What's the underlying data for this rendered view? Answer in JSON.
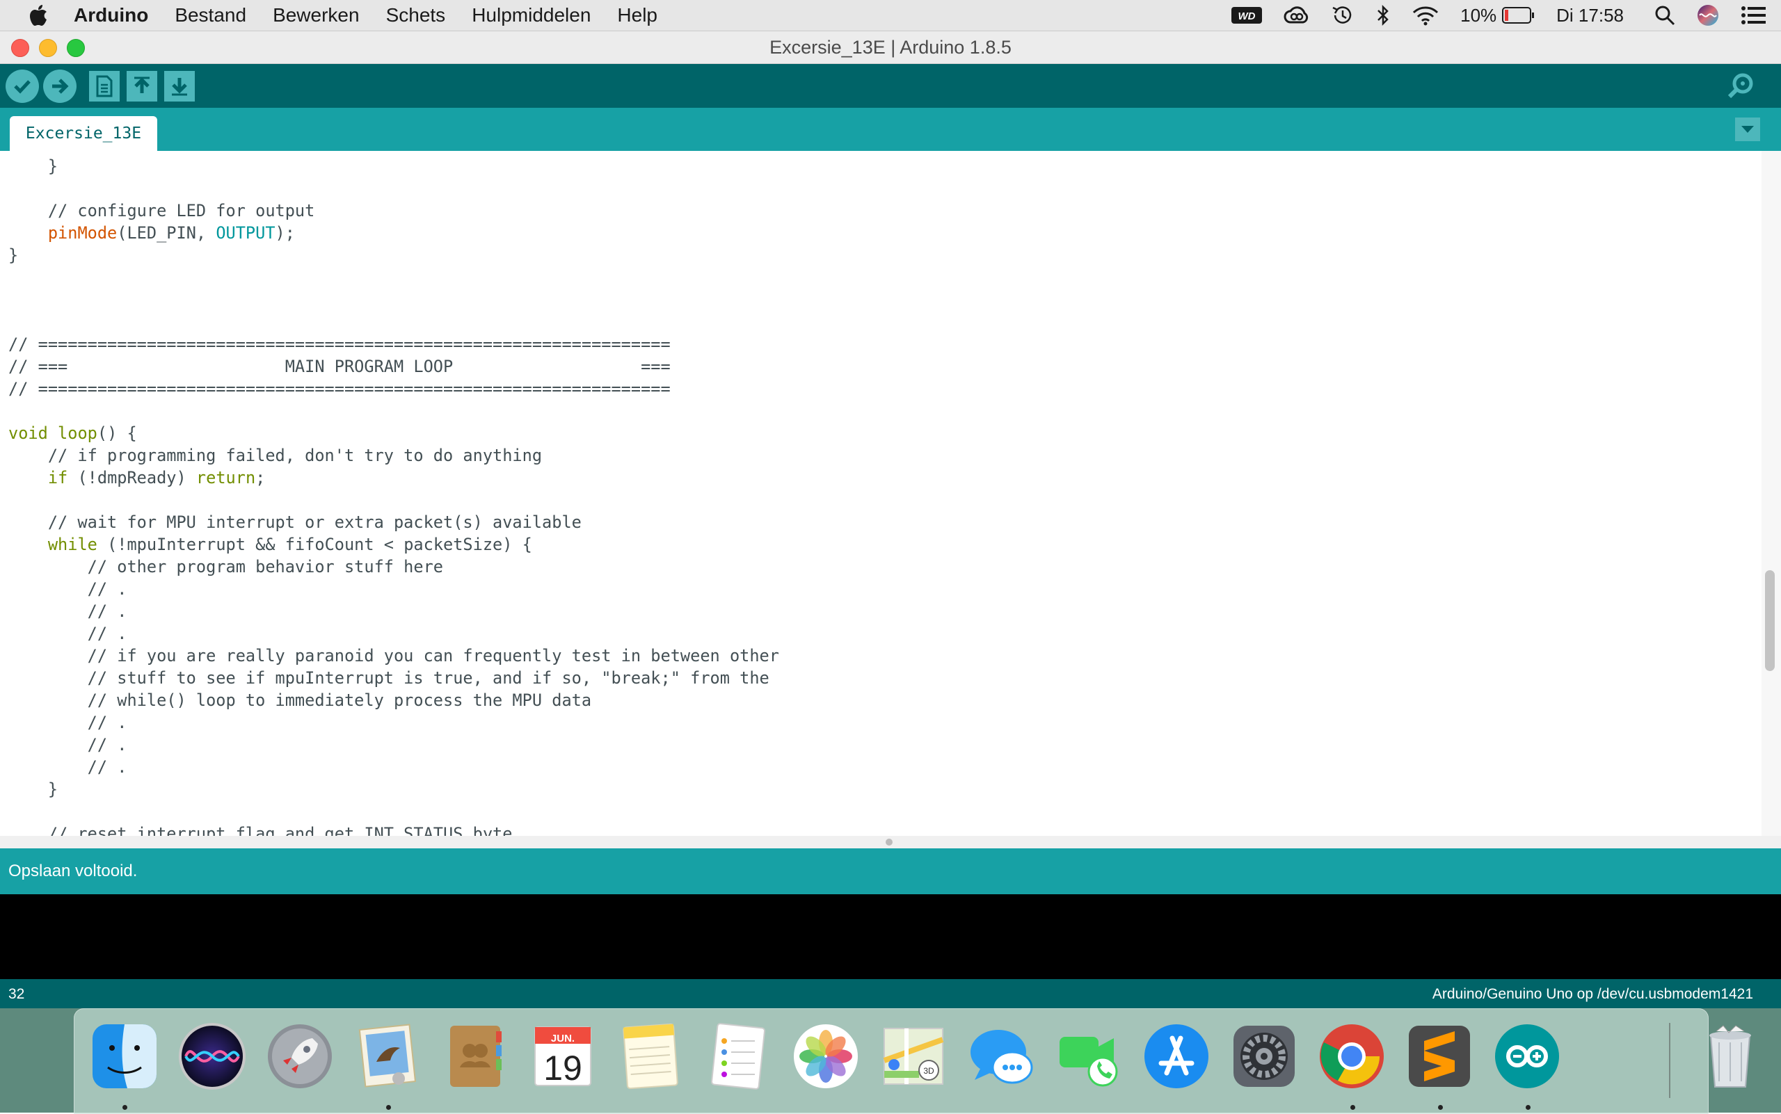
{
  "menubar": {
    "app_name": "Arduino",
    "items": [
      "Bestand",
      "Bewerken",
      "Schets",
      "Hulpmiddelen",
      "Help"
    ],
    "battery_percent": "10%",
    "clock": "Di 17:58"
  },
  "window": {
    "title": "Excersie_13E | Arduino 1.8.5",
    "tab_label": "Excersie_13E"
  },
  "editor": {
    "lines": [
      {
        "text": "    }"
      },
      {
        "text": ""
      },
      {
        "text": "    // configure LED for output"
      },
      {
        "segments": [
          {
            "t": "    ",
            "c": ""
          },
          {
            "t": "pinMode",
            "c": "fn"
          },
          {
            "t": "(LED_PIN, ",
            "c": ""
          },
          {
            "t": "OUTPUT",
            "c": "cn"
          },
          {
            "t": ");",
            "c": ""
          }
        ]
      },
      {
        "text": "}"
      },
      {
        "text": ""
      },
      {
        "text": ""
      },
      {
        "text": ""
      },
      {
        "text": "// ================================================================"
      },
      {
        "text": "// ===                      MAIN PROGRAM LOOP                   ==="
      },
      {
        "text": "// ================================================================"
      },
      {
        "text": ""
      },
      {
        "segments": [
          {
            "t": "void",
            "c": "kw"
          },
          {
            "t": " ",
            "c": ""
          },
          {
            "t": "loop",
            "c": "kw"
          },
          {
            "t": "() {",
            "c": ""
          }
        ]
      },
      {
        "text": "    // if programming failed, don't try to do anything"
      },
      {
        "segments": [
          {
            "t": "    ",
            "c": ""
          },
          {
            "t": "if",
            "c": "kw"
          },
          {
            "t": " (!dmpReady) ",
            "c": ""
          },
          {
            "t": "return",
            "c": "kw"
          },
          {
            "t": ";",
            "c": ""
          }
        ]
      },
      {
        "text": ""
      },
      {
        "text": "    // wait for MPU interrupt or extra packet(s) available"
      },
      {
        "segments": [
          {
            "t": "    ",
            "c": ""
          },
          {
            "t": "while",
            "c": "kw"
          },
          {
            "t": " (!mpuInterrupt && fifoCount < packetSize) {",
            "c": ""
          }
        ]
      },
      {
        "text": "        // other program behavior stuff here"
      },
      {
        "text": "        // ."
      },
      {
        "text": "        // ."
      },
      {
        "text": "        // ."
      },
      {
        "text": "        // if you are really paranoid you can frequently test in between other"
      },
      {
        "text": "        // stuff to see if mpuInterrupt is true, and if so, \"break;\" from the"
      },
      {
        "text": "        // while() loop to immediately process the MPU data"
      },
      {
        "text": "        // ."
      },
      {
        "text": "        // ."
      },
      {
        "text": "        // ."
      },
      {
        "text": "    }"
      },
      {
        "text": ""
      },
      {
        "text": "    // reset interrupt flag and get INT_STATUS byte"
      }
    ]
  },
  "status": {
    "message": "Opslaan voltooid.",
    "line_number": "32",
    "board": "Arduino/Genuino Uno op /dev/cu.usbmodem1421"
  },
  "dock": {
    "apps": [
      "Finder",
      "Siri",
      "Launchpad",
      "Mail",
      "Contacts",
      "Calendar",
      "Notes",
      "Reminders",
      "Photos",
      "Maps",
      "Messages",
      "FaceTime",
      "App Store",
      "System Preferences",
      "Google Chrome",
      "Sublime Text",
      "Arduino",
      "Trash"
    ],
    "calendar_month": "JUN.",
    "calendar_day": "19"
  },
  "colors": {
    "toolbar": "#006468",
    "tabbar": "#17a1a5",
    "keyword": "#728e00",
    "function": "#d35400",
    "constant": "#00979c",
    "text": "#434f54"
  }
}
